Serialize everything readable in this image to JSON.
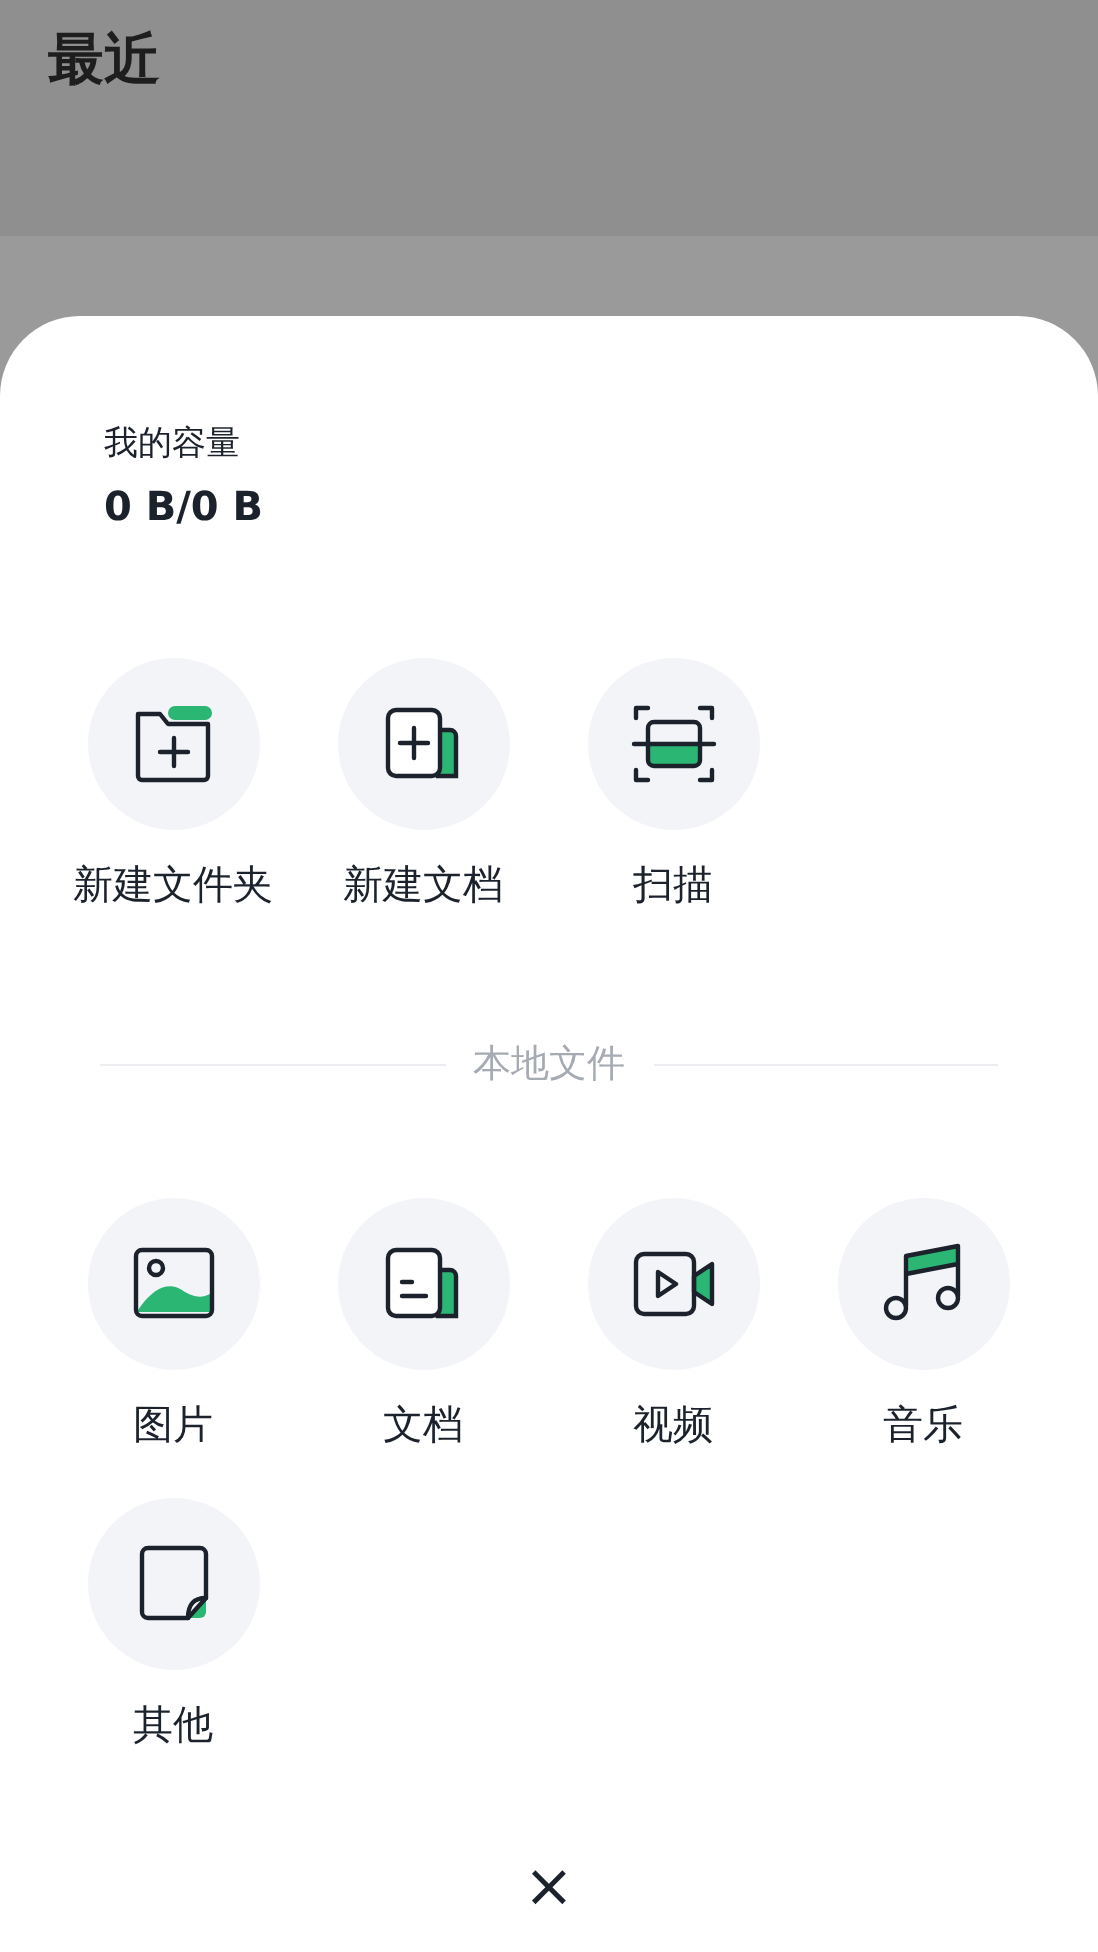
{
  "background_title": "最近",
  "storage": {
    "label": "我的容量",
    "value": "0 B/0 B"
  },
  "actions": [
    {
      "kind": "new-folder",
      "label": "新建文件夹"
    },
    {
      "kind": "new-document",
      "label": "新建文档"
    },
    {
      "kind": "scan",
      "label": "扫描"
    }
  ],
  "local_files": {
    "heading": "本地文件",
    "items": [
      {
        "kind": "image",
        "label": "图片"
      },
      {
        "kind": "document",
        "label": "文档"
      },
      {
        "kind": "video",
        "label": "视频"
      },
      {
        "kind": "music",
        "label": "音乐"
      },
      {
        "kind": "other",
        "label": "其他"
      }
    ]
  },
  "close_button": "×"
}
